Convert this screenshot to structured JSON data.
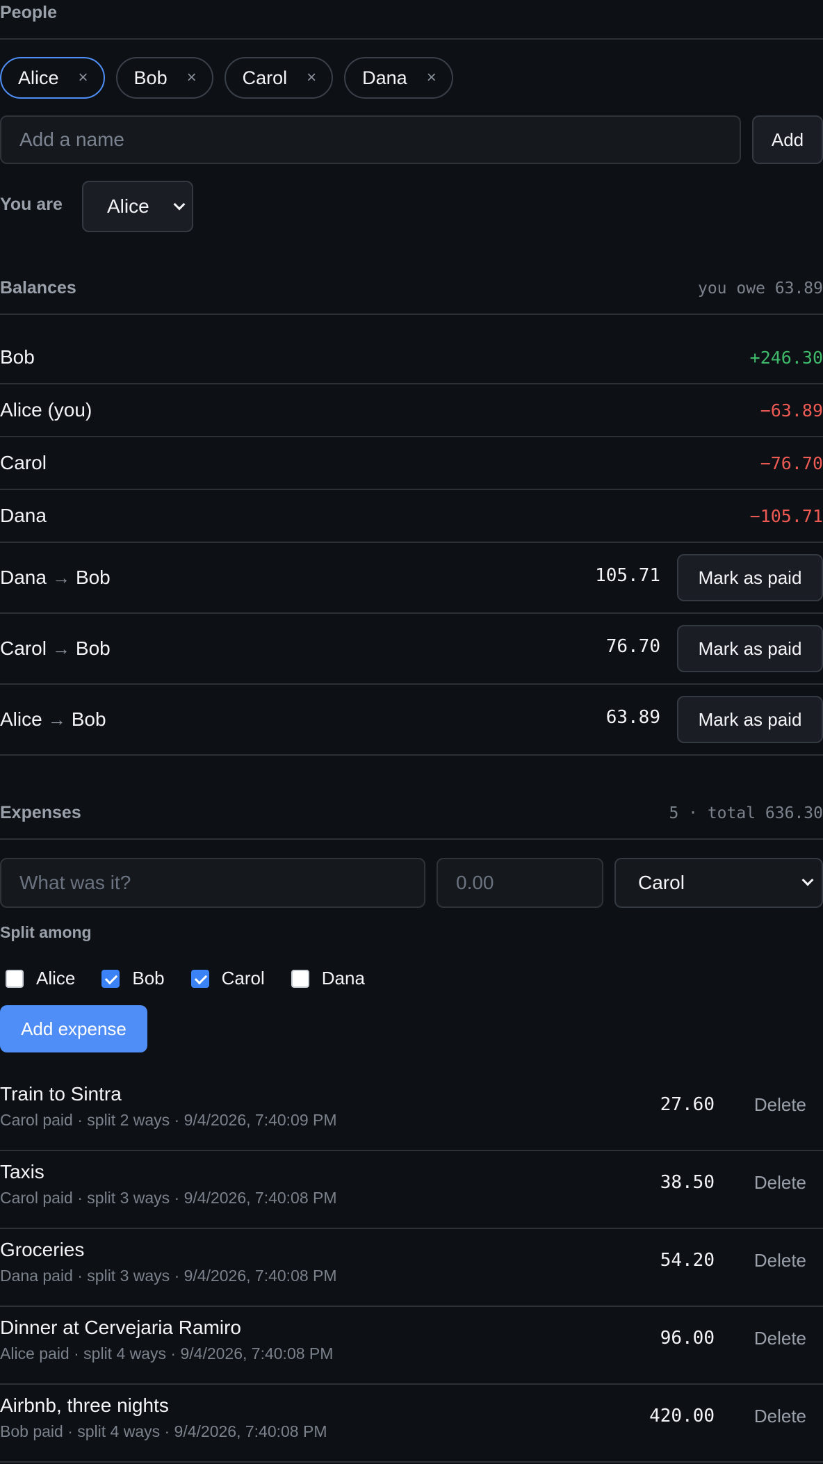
{
  "people": {
    "title": "People",
    "members": [
      {
        "name": "Alice",
        "remove": "×",
        "active": true
      },
      {
        "name": "Bob",
        "remove": "×",
        "active": false
      },
      {
        "name": "Carol",
        "remove": "×",
        "active": false
      },
      {
        "name": "Dana",
        "remove": "×",
        "active": false
      }
    ],
    "add_placeholder": "Add a name",
    "add_label": "Add",
    "you_are_label": "You are",
    "you_are_value": "Alice"
  },
  "balances": {
    "title": "Balances",
    "summary": "you owe 63.89",
    "rows": [
      {
        "name": "Bob",
        "amount": "+246.30",
        "status": "positive"
      },
      {
        "name": "Alice (you)",
        "amount": "−63.89",
        "status": "negative"
      },
      {
        "name": "Carol",
        "amount": "−76.70",
        "status": "negative"
      },
      {
        "name": "Dana",
        "amount": "−105.71",
        "status": "negative"
      }
    ],
    "settlements": [
      {
        "from": "Dana",
        "arrow": "→",
        "to": "Bob",
        "amount": "105.71",
        "action": "Mark as paid"
      },
      {
        "from": "Carol",
        "arrow": "→",
        "to": "Bob",
        "amount": "76.70",
        "action": "Mark as paid"
      },
      {
        "from": "Alice",
        "arrow": "→",
        "to": "Bob",
        "amount": "63.89",
        "action": "Mark as paid"
      }
    ]
  },
  "expenses": {
    "title": "Expenses",
    "summary": "5 · total 636.30",
    "form": {
      "description_placeholder": "What was it?",
      "amount_placeholder": "0.00",
      "payer": "Carol",
      "split_label": "Split among",
      "split": [
        {
          "name": "Alice",
          "checked": false
        },
        {
          "name": "Bob",
          "checked": true
        },
        {
          "name": "Carol",
          "checked": true
        },
        {
          "name": "Dana",
          "checked": false
        }
      ],
      "submit_label": "Add expense"
    },
    "items": [
      {
        "title": "Train to Sintra",
        "meta": "Carol paid · split 2 ways · 9/4/2026, 7:40:09 PM",
        "amount": "27.60",
        "delete": "Delete"
      },
      {
        "title": "Taxis",
        "meta": "Carol paid · split 3 ways · 9/4/2026, 7:40:08 PM",
        "amount": "38.50",
        "delete": "Delete"
      },
      {
        "title": "Groceries",
        "meta": "Dana paid · split 3 ways · 9/4/2026, 7:40:08 PM",
        "amount": "54.20",
        "delete": "Delete"
      },
      {
        "title": "Dinner at Cervejaria Ramiro",
        "meta": "Alice paid · split 4 ways · 9/4/2026, 7:40:08 PM",
        "amount": "96.00",
        "delete": "Delete"
      },
      {
        "title": "Airbnb, three nights",
        "meta": "Bob paid · split 4 ways · 9/4/2026, 7:40:08 PM",
        "amount": "420.00",
        "delete": "Delete"
      }
    ]
  },
  "colors": {
    "accent": "#4f8ef7",
    "positive": "#3fb96a",
    "negative": "#ee5a54",
    "background": "#0d1014"
  }
}
